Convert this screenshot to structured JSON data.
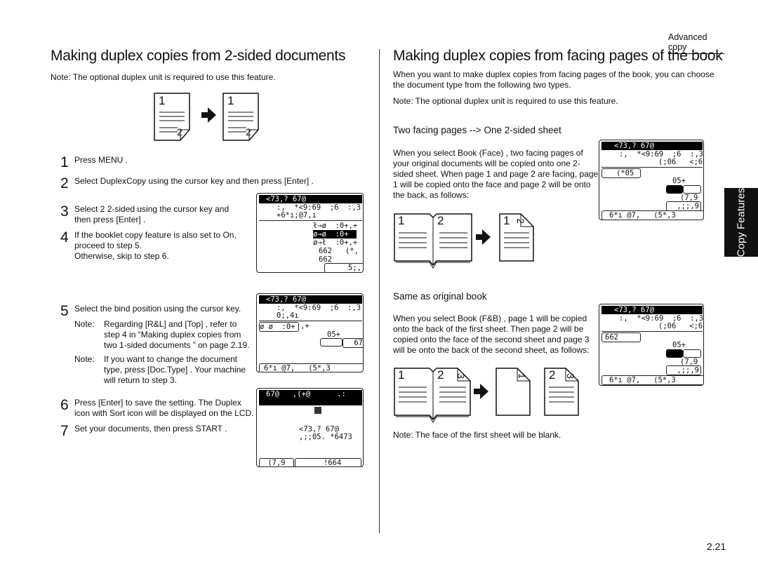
{
  "header": {
    "section": "Advanced copy"
  },
  "side_tab": {
    "label": "Copy Features"
  },
  "page_number": "2.21",
  "left": {
    "title": "Making duplex copies from 2-sided documents",
    "note": "Note:    The optional duplex unit is required to use this feature.",
    "diagram": {
      "page_front": "1",
      "page_back": "2"
    },
    "steps": [
      {
        "n": "1",
        "lines": [
          "Press MENU ."
        ]
      },
      {
        "n": "2",
        "lines": [
          "Select  DuplexCopy      using the cursor key and then press   [Enter]  ."
        ]
      },
      {
        "n": "3",
        "lines": [
          "Select  2   2-sided    using the cursor key and",
          "then press  [Enter]  ."
        ]
      },
      {
        "n": "4",
        "lines": [
          "If the booklet copy feature is also set to   On,",
          "proceed to step 5.",
          "Otherwise, skip to step 6."
        ]
      },
      {
        "n": "5",
        "lines": [
          "Select the bind position using the cursor key."
        ]
      },
      {
        "n": "6",
        "lines": [
          "Press [Enter]    to save the setting. The   Duplex",
          "icon with  Sort  icon will be displayed on the   LCD."
        ]
      },
      {
        "n": "7",
        "lines": [
          "Set your documents, then press  START ."
        ]
      }
    ],
    "step5_notes": [
      {
        "label": "Note:",
        "lines": [
          "Regarding  [R&L]   and [Top]  , refer to",
          "step 4 in  “Making duplex copies from",
          "two 1-sided documents ” on page 2.19."
        ]
      },
      {
        "label": "Note:",
        "lines": [
          "If you want to change the document",
          "type, press  [Doc.Type]  . Your machine",
          "will return to step 3."
        ]
      }
    ],
    "lcd1": [
      "<73,? 67@",
      ":,  *<9:69  ;6  :,3",
      "+6*ı;@7,ı",
      "ł→ø  :0+,+",
      "ø→ø  :0+",
      "ø→ł  :0+,+",
      "662   (*,",
      "662",
      "5;,"
    ],
    "lcd2": [
      "<73,? 67@",
      ":,  *<9:69  ;6  :,3",
      "0;,4ı",
      "ø ø  :0+",
      ",+",
      "05+",
      "67",
      "6*ı @7,   (5*,3"
    ],
    "lcd3": [
      "67@   ,(+@      .:",
      "<73,? 67@",
      ",;;05. *6473",
      "(7,9",
      "!664"
    ]
  },
  "right": {
    "title": "Making duplex copies from facing pages of the book",
    "intro": [
      "When you want to make duplex copies from facing pages of the book, you can choose",
      "the document type from the following two types."
    ],
    "note": "Note:    The optional duplex unit is required to use this feature.",
    "section1": {
      "heading": "Two facing pages --> One 2-sided sheet",
      "text": [
        "When you select   Book (Face)     , two facing pages of",
        "your original documents will be copied onto one 2-",
        "sided sheet. When page 1 and page 2 are facing, page",
        "1 will be copied onto the face and page 2 will be onto",
        "the back, as follows:"
      ],
      "diagram": {
        "book_left": "1",
        "book_right": "2",
        "out_front": "1",
        "out_back": "2"
      },
      "lcd": [
        "<73,? 67@",
        ":,  *<9:69  ;6  :,3",
        "(;06   <;6",
        "(*05",
        "05+",
        "(7,9",
        ",;;,9",
        "6*ı @7,   (5*,3"
      ]
    },
    "section2": {
      "heading": "Same as original book",
      "text": [
        "When you select   Book (F&B)     , page 1 will be copied",
        "onto the back of the first sheet. Then page 2 will be",
        "copied onto the face of the second sheet and page 3",
        "will be onto the back of the second sheet, as follows:"
      ],
      "diagram": {
        "book_left": "1",
        "book_right": "2",
        "book_corner": "3",
        "sheet1_back": "1",
        "sheet2_front": "2",
        "sheet2_back": "3"
      },
      "lcd": [
        "<73,? 67@",
        ":,  *<9:69  ;6  :,3",
        "(;06   <;6",
        "662",
        "05+",
        "(7,9",
        ",;;,9",
        "6*ı @7,   (5*,3"
      ],
      "note": "Note:    The face of the first sheet will be blank."
    }
  }
}
